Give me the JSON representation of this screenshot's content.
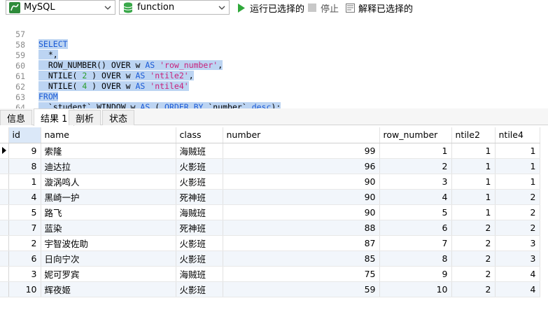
{
  "toolbar": {
    "connection": "MySQL",
    "database": "function",
    "run_selected": "运行已选择的",
    "stop": "停止",
    "explain_selected": "解释已选择的"
  },
  "editor": {
    "lines": [
      {
        "no": "57"
      },
      {
        "no": "58"
      },
      {
        "no": "59"
      },
      {
        "no": "60"
      },
      {
        "no": "61"
      },
      {
        "no": "62"
      },
      {
        "no": "63"
      },
      {
        "no": "64"
      }
    ]
  },
  "tabs": [
    "信息",
    "结果 1",
    "剖析",
    "状态"
  ],
  "grid": {
    "columns": [
      "id",
      "name",
      "class",
      "number",
      "row_number",
      "ntile2",
      "ntile4"
    ],
    "rows": [
      [
        "9",
        "索隆",
        "海贼班",
        "99",
        "1",
        "1",
        "1"
      ],
      [
        "8",
        "迪达拉",
        "火影班",
        "96",
        "2",
        "1",
        "1"
      ],
      [
        "1",
        "漩涡鸣人",
        "火影班",
        "90",
        "3",
        "1",
        "1"
      ],
      [
        "4",
        "黑崎一护",
        "死神班",
        "90",
        "4",
        "1",
        "2"
      ],
      [
        "5",
        "路飞",
        "海贼班",
        "90",
        "5",
        "1",
        "2"
      ],
      [
        "7",
        "蓝染",
        "死神班",
        "88",
        "6",
        "2",
        "2"
      ],
      [
        "2",
        "宇智波佐助",
        "火影班",
        "87",
        "7",
        "2",
        "3"
      ],
      [
        "6",
        "日向宁次",
        "火影班",
        "85",
        "8",
        "2",
        "3"
      ],
      [
        "3",
        "妮可罗宾",
        "海贼班",
        "75",
        "9",
        "2",
        "4"
      ],
      [
        "10",
        "辉夜姬",
        "火影班",
        "59",
        "10",
        "2",
        "4"
      ]
    ]
  }
}
